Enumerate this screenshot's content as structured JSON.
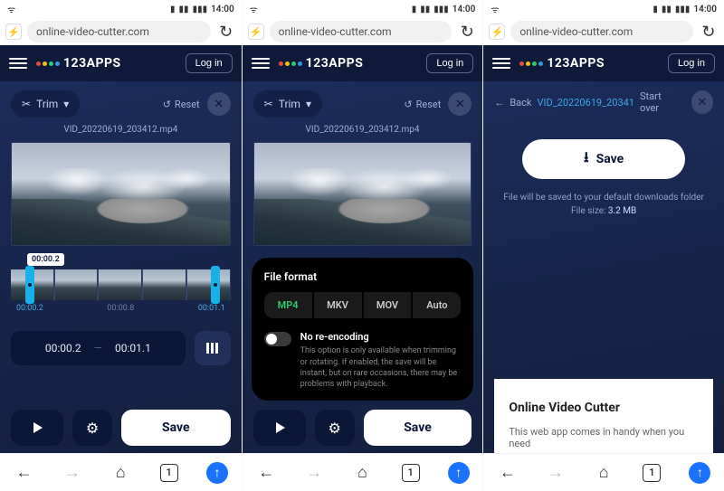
{
  "status": {
    "time": "14:00"
  },
  "address": {
    "url": "online-video-cutter.com"
  },
  "header": {
    "brand": "123APPS",
    "login": "Log in"
  },
  "toolbar": {
    "trim": "Trim",
    "reset": "Reset"
  },
  "file": {
    "name": "VID_20220619_203412.mp4",
    "short": "VID_20220619_20341"
  },
  "timeline": {
    "badge": "00:00.2",
    "t1": "00:00.2",
    "t2": "00:00.8",
    "t3": "00:01.1",
    "start": "00:00.2",
    "end": "00:01.1"
  },
  "actions": {
    "save": "Save"
  },
  "format_panel": {
    "title": "File format",
    "opts": [
      "MP4",
      "MKV",
      "MOV",
      "Auto"
    ],
    "toggle_label": "No re-encoding",
    "toggle_desc": "This option is only available when trimming or rotating. If enabled, the save will be instant, but on rare occasions, there may be problems with playback."
  },
  "screen3": {
    "back": "Back",
    "startover": "Start over",
    "save": "Save",
    "note": "File will be saved to your default downloads folder",
    "size_label": "File size:",
    "size_value": "3.2 MB",
    "section_title": "Online Video Cutter",
    "section_body": "This web app comes in handy when you need"
  },
  "nav": {
    "tabs": "1"
  }
}
